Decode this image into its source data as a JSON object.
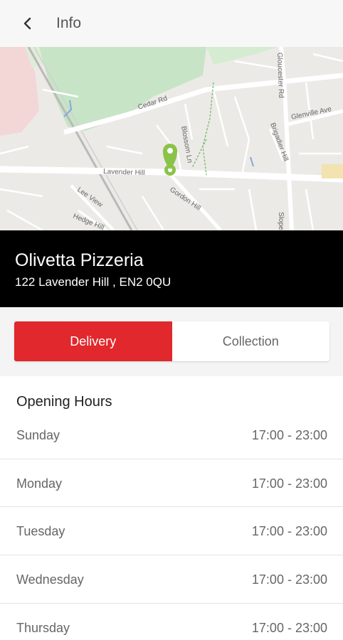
{
  "appbar": {
    "title": "Info",
    "back_icon": "back-arrow-icon"
  },
  "map": {
    "streets": [
      "Cedar Rd",
      "Gloucester Rd",
      "Glenville Ave",
      "Blossom Ln",
      "Brigadier Hill",
      "Lavender Hill",
      "Gordon Hill",
      "Lee View",
      "Hedge Hill",
      "Slopes"
    ],
    "pin_icon": "location-pin-icon",
    "pin_color": "#8bc34a"
  },
  "restaurant": {
    "name": "Olivetta Pizzeria",
    "address": "122 Lavender Hill , EN2 0QU"
  },
  "order_mode": {
    "delivery_label": "Delivery",
    "collection_label": "Collection",
    "selected": "Delivery",
    "accent": "#e0282d"
  },
  "opening_hours": {
    "title": "Opening Hours",
    "days": [
      {
        "day": "Sunday",
        "hours": "17:00 - 23:00"
      },
      {
        "day": "Monday",
        "hours": "17:00 - 23:00"
      },
      {
        "day": "Tuesday",
        "hours": "17:00 - 23:00"
      },
      {
        "day": "Wednesday",
        "hours": "17:00 - 23:00"
      },
      {
        "day": "Thursday",
        "hours": "17:00 - 23:00"
      }
    ]
  }
}
